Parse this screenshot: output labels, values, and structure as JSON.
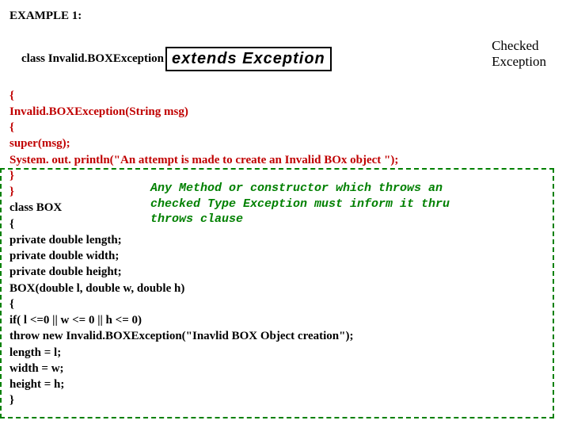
{
  "title": "EXAMPLE 1:",
  "code": {
    "line1_prefix": "class Invalid.BOXException",
    "line1_box": "extends Exception",
    "line2": "{",
    "line3": "Invalid.BOXException(String msg)",
    "line4": "{",
    "line5": "super(msg);",
    "line6": "System. out. println(\"An attempt is made to create an Invalid BOx object \");",
    "line7": "}",
    "line8": "}",
    "line9": "class BOX",
    "line10": "{",
    "line11": "private double length;",
    "line12": "private double width;",
    "line13": "private double height;",
    "line14": "BOX(double l, double w, double h)",
    "line15": "{",
    "line16": "if( l <=0 || w <= 0 || h <= 0)",
    "line17": "throw new Invalid.BOXException(\"Inavlid BOX Object creation\");",
    "line18": "length = l;",
    "line19": "width = w;",
    "line20": "height = h;",
    "line21": "}"
  },
  "annotation_right": {
    "l1": "Checked",
    "l2": "Exception"
  },
  "annotation_green": {
    "l1": "Any Method or constructor which throws an",
    "l2": "checked Type Exception must inform it thru",
    "l3": "throws clause"
  }
}
